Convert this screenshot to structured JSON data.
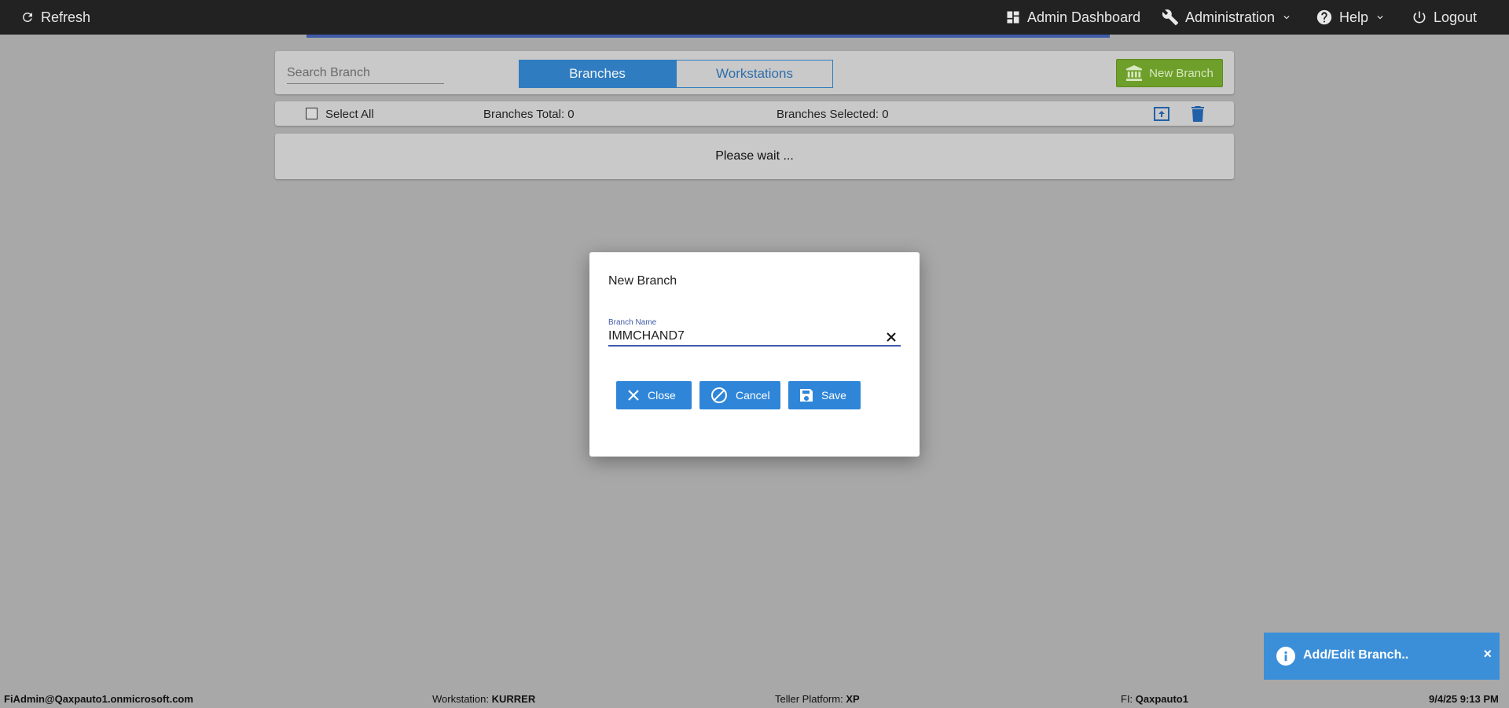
{
  "topbar": {
    "refresh_label": "Refresh",
    "admin_dashboard_label": "Admin Dashboard",
    "administration_label": "Administration",
    "help_label": "Help",
    "logout_label": "Logout"
  },
  "toolbar": {
    "search_placeholder": "Search Branch",
    "tab_branches": "Branches",
    "tab_workstations": "Workstations",
    "new_branch_label": "New Branch"
  },
  "selection": {
    "select_all_label": "Select All",
    "branches_total": "Branches Total: 0",
    "branches_selected": "Branches Selected: 0"
  },
  "list": {
    "status_text": "Please wait ..."
  },
  "modal": {
    "title": "New Branch",
    "field_label": "Branch Name",
    "field_value": "IMMCHAND7",
    "close_label": "Close",
    "cancel_label": "Cancel",
    "save_label": "Save"
  },
  "toast": {
    "message": "Add/Edit Branch..",
    "close_glyph": "×"
  },
  "statusbar": {
    "user": "FiAdmin@Qaxpauto1.onmicrosoft.com",
    "workstation_label": "Workstation: ",
    "workstation_value": "KURRER",
    "platform_label": "Teller Platform: ",
    "platform_value": "XP",
    "fi_label": "FI: ",
    "fi_value": "Qaxpauto1",
    "datetime": "9/4/25 9:13 PM"
  },
  "colors": {
    "topbar_bg": "#222222",
    "primary_blue": "#2f7cc0",
    "new_branch_green": "#6e9f2a",
    "toast_blue": "#3b8fd8",
    "accent_line": "#3f5aa8"
  }
}
